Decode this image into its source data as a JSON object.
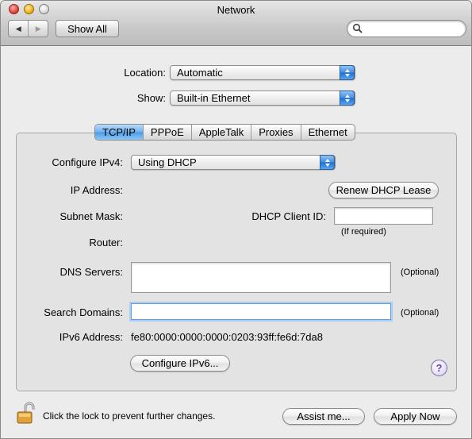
{
  "window": {
    "title": "Network"
  },
  "toolbar": {
    "back_icon": "back-arrow-icon",
    "forward_icon": "forward-arrow-icon",
    "show_all_label": "Show All",
    "search_placeholder": ""
  },
  "location": {
    "label": "Location:",
    "value": "Automatic"
  },
  "show": {
    "label": "Show:",
    "value": "Built-in Ethernet"
  },
  "tabs": [
    {
      "label": "TCP/IP",
      "active": true
    },
    {
      "label": "PPPoE",
      "active": false
    },
    {
      "label": "AppleTalk",
      "active": false
    },
    {
      "label": "Proxies",
      "active": false
    },
    {
      "label": "Ethernet",
      "active": false
    }
  ],
  "tcpip": {
    "configure_label": "Configure IPv4:",
    "configure_value": "Using DHCP",
    "ip_address_label": "IP Address:",
    "renew_label": "Renew DHCP Lease",
    "subnet_label": "Subnet Mask:",
    "dhcp_client_label": "DHCP Client ID:",
    "dhcp_client_value": "",
    "if_required": "(If required)",
    "router_label": "Router:",
    "dns_label": "DNS Servers:",
    "dns_value": "",
    "dns_optional": "(Optional)",
    "search_label": "Search Domains:",
    "search_value": "",
    "search_optional": "(Optional)",
    "ipv6_label": "IPv6 Address:",
    "ipv6_value": "fe80:0000:0000:0000:0203:93ff:fe6d:7da8",
    "configure_ipv6_label": "Configure IPv6...",
    "help_label": "?"
  },
  "footer": {
    "lock_text": "Click the lock to prevent further changes.",
    "assist_label": "Assist me...",
    "apply_label": "Apply Now"
  },
  "colors": {
    "accent": "#3f8de0",
    "tab_active": "#6fb1f0",
    "focus_ring": "#a9cdf4"
  }
}
